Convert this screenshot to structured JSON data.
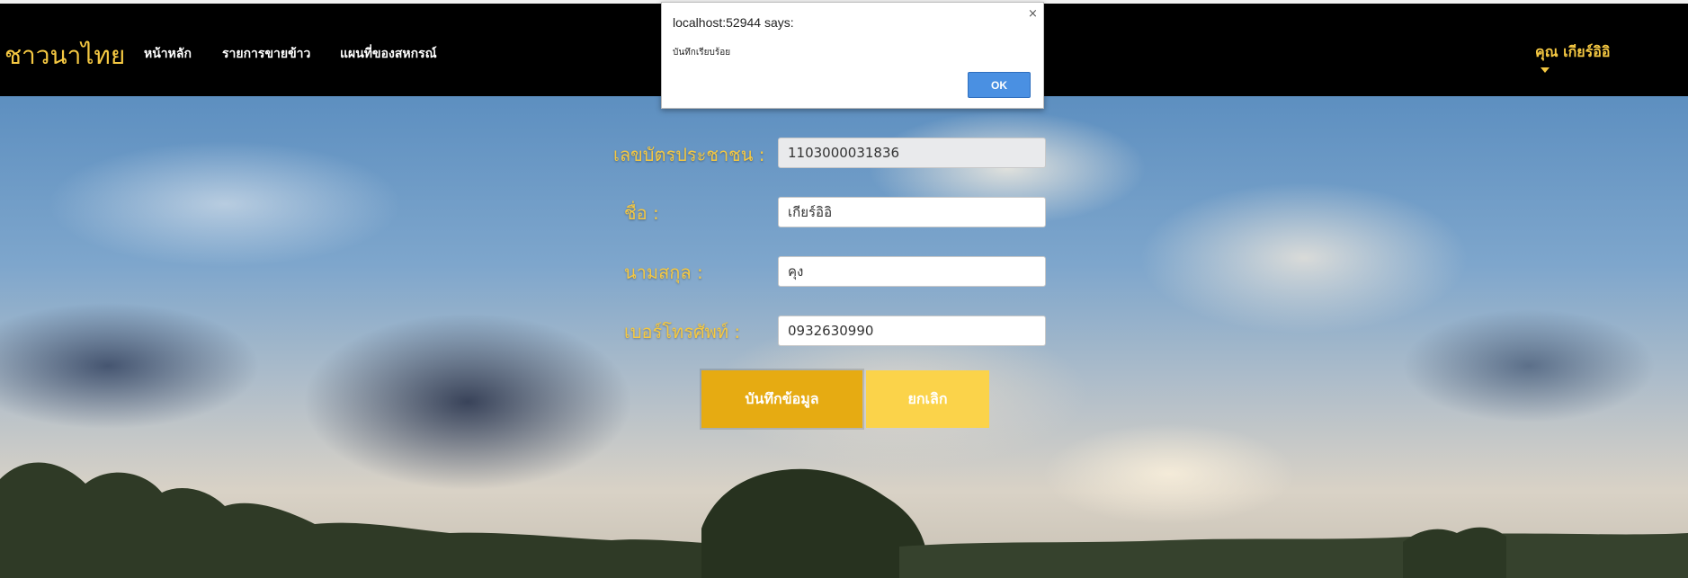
{
  "navbar": {
    "brand": "ชาวนาไทย",
    "links": [
      "หน้าหลัก",
      "รายการขายข้าว",
      "แผนที่ของสหกรณ์"
    ],
    "user": "คุณ เกียร์อิอิ"
  },
  "form": {
    "labels": [
      "เลขบัตรประชาชน :",
      "ชื่อ :",
      "นามสกุล :",
      "เบอร์โทรศัพท์ :"
    ],
    "values": {
      "id_card": "1103000031836",
      "first_name": "เกียร์อิอิ",
      "last_name": "คุง",
      "phone": "0932630990"
    },
    "save_label": "บันทึกข้อมูล",
    "cancel_label": "ยกเลิก"
  },
  "dialog": {
    "title": "localhost:52944 says:",
    "message": "บันทึกเรียบร้อย",
    "ok_label": "OK",
    "close_glyph": "×"
  },
  "colors": {
    "accent": "#f5c842",
    "save_button": "#e6ab12",
    "cancel_button": "#fbd34a",
    "navbar": "#000000"
  }
}
